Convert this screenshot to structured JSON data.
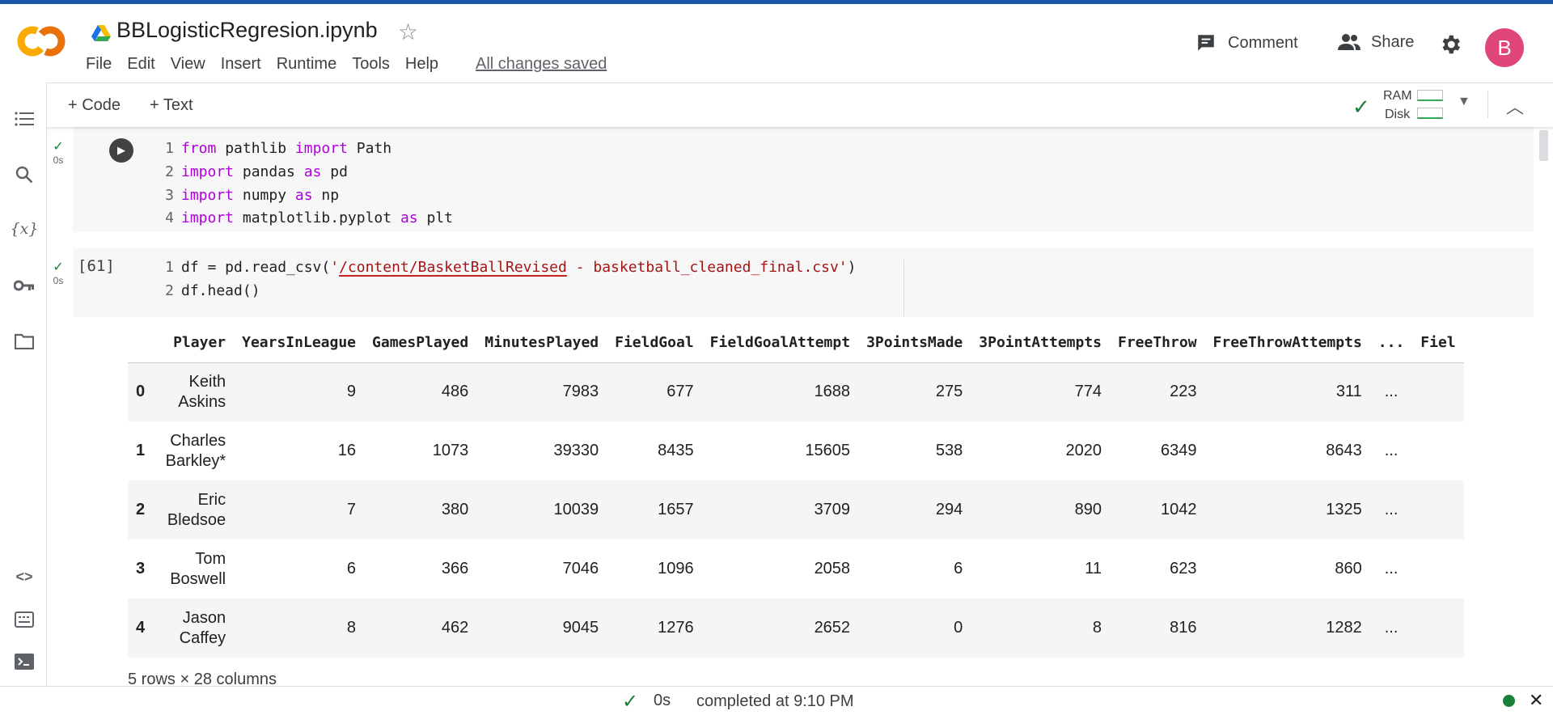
{
  "header": {
    "title": "BBLogisticRegresion.ipynb",
    "menu": [
      "File",
      "Edit",
      "View",
      "Insert",
      "Runtime",
      "Tools",
      "Help"
    ],
    "saved_status": "All changes saved",
    "comment_label": "Comment",
    "share_label": "Share",
    "avatar_letter": "B"
  },
  "toolbar": {
    "add_code_label": "+ Code",
    "add_text_label": "+ Text",
    "ram_label": "RAM",
    "disk_label": "Disk"
  },
  "cells": [
    {
      "status": "0s",
      "exec_count": "",
      "lines": [
        {
          "n": "1",
          "code": "from pathlib import Path"
        },
        {
          "n": "2",
          "code": "import pandas as pd"
        },
        {
          "n": "3",
          "code": "import numpy as np"
        },
        {
          "n": "4",
          "code": "import matplotlib.pyplot as plt"
        }
      ]
    },
    {
      "status": "0s",
      "exec_count": "[61]",
      "lines": [
        {
          "n": "1",
          "code": "df = pd.read_csv('/content/BasketBallRevised - basketball_cleaned_final.csv')"
        },
        {
          "n": "2",
          "code": "df.head()"
        }
      ]
    }
  ],
  "output": {
    "columns": [
      "",
      "Player",
      "YearsInLeague",
      "GamesPlayed",
      "MinutesPlayed",
      "FieldGoal",
      "FieldGoalAttempt",
      "3PointsMade",
      "3PointAttempts",
      "FreeThrow",
      "FreeThrowAttempts",
      "...",
      "Fiel"
    ],
    "rows": [
      [
        "0",
        "Keith Askins",
        "9",
        "486",
        "7983",
        "677",
        "1688",
        "275",
        "774",
        "223",
        "311",
        "...",
        ""
      ],
      [
        "1",
        "Charles Barkley*",
        "16",
        "1073",
        "39330",
        "8435",
        "15605",
        "538",
        "2020",
        "6349",
        "8643",
        "...",
        ""
      ],
      [
        "2",
        "Eric Bledsoe",
        "7",
        "380",
        "10039",
        "1657",
        "3709",
        "294",
        "890",
        "1042",
        "1325",
        "...",
        ""
      ],
      [
        "3",
        "Tom Boswell",
        "6",
        "366",
        "7046",
        "1096",
        "2058",
        "6",
        "11",
        "623",
        "860",
        "...",
        ""
      ],
      [
        "4",
        "Jason Caffey",
        "8",
        "462",
        "9045",
        "1276",
        "2652",
        "0",
        "8",
        "816",
        "1282",
        "...",
        ""
      ]
    ],
    "shape_note": "5 rows × 28 columns"
  },
  "statusbar": {
    "duration": "0s",
    "text": "completed at 9:10 PM"
  },
  "colors": {
    "keyword": "#af00db",
    "string": "#a31515",
    "avatar": "#e0457b",
    "success": "#188038",
    "top_accent": "#1a56a8"
  },
  "icons": [
    "colab-logo",
    "drive-icon",
    "star-icon",
    "comment-icon",
    "people-icon",
    "gear-icon",
    "toc-icon",
    "search-icon",
    "variables-icon",
    "key-icon",
    "folder-icon",
    "code-snippets-icon",
    "command-palette-icon",
    "terminal-icon",
    "play-icon",
    "check-icon",
    "chevron-down-icon",
    "chevron-up-icon",
    "close-icon"
  ]
}
